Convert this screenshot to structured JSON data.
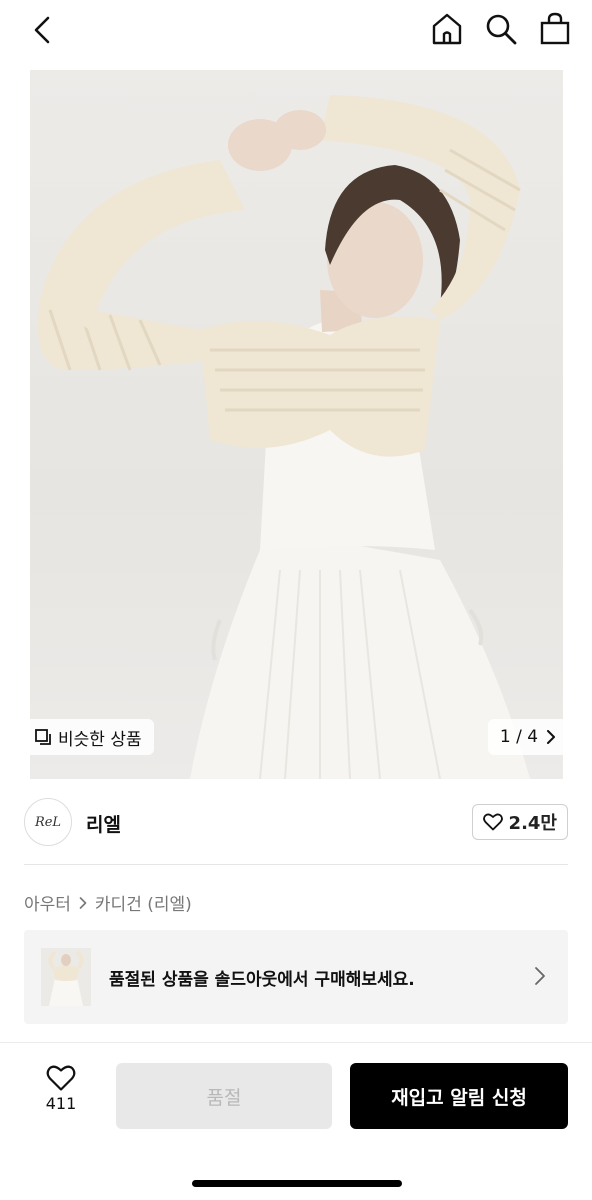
{
  "header": {
    "back_icon": "chevron-left-icon",
    "icons": [
      "home-icon",
      "search-icon",
      "shopping-bag-icon"
    ]
  },
  "gallery": {
    "similar_label": "비슷한 상품",
    "pager": "1 / 4"
  },
  "brand": {
    "logo_text": "ReL",
    "name": "리엘",
    "likes": "2.4만"
  },
  "breadcrumb": {
    "category": "아우터",
    "subcategory": "카디건 (리엘)"
  },
  "soldout_banner": {
    "text": "품절된 상품을 솔드아웃에서 구매해보세요."
  },
  "bottom_bar": {
    "wish_count": "411",
    "soldout_label": "품절",
    "restock_label": "재입고 알림 신청"
  },
  "colors": {
    "accent": "#000000",
    "disabled_bg": "#e8e8e8",
    "disabled_text": "#b8b8b8"
  }
}
